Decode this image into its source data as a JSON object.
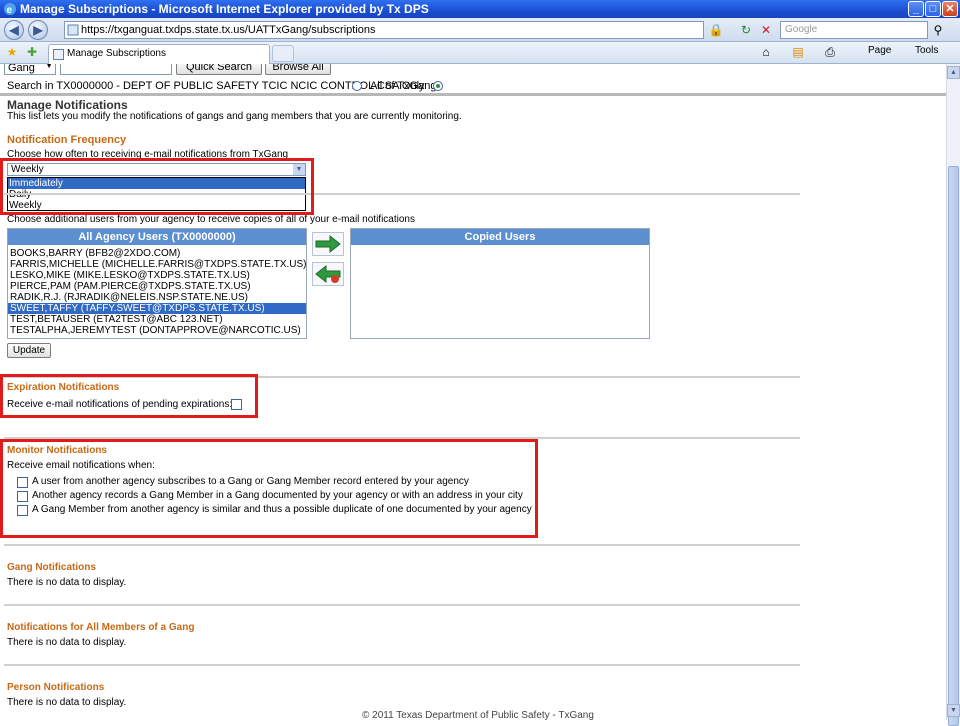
{
  "window": {
    "title": "Manage Subscriptions - Microsoft Internet Explorer provided by Tx DPS"
  },
  "browser": {
    "url": "https://txganguat.txdps.state.tx.us/UATTxGang/subscriptions",
    "search_placeholder": "Google",
    "tab_title": "Manage Subscriptions",
    "toolbar": {
      "page": "Page",
      "tools": "Tools"
    }
  },
  "search_bar": {
    "type_value": "Gang",
    "quick_search": "Quick Search",
    "browse_all": "Browse All",
    "scope_text": "Search in TX0000000 - DEPT OF PUBLIC SAFETY TCIC NCIC CONTROL CSA Only",
    "scope_all": "All of TxGang"
  },
  "page": {
    "title": "Manage Notifications",
    "intro": "This list lets you modify the notifications of gangs and gang members that you are currently monitoring."
  },
  "frequency": {
    "heading": "Notification Frequency",
    "label": "Choose how often to receiving e-mail notifications from TxGang",
    "selected": "Weekly",
    "options": [
      "Immediately",
      "Daily",
      "Weekly"
    ],
    "highlighted": "Immediately"
  },
  "copies": {
    "label": "Choose additional users from your agency to receive copies of all of your e-mail notifications",
    "agency_header": "All Agency Users (TX0000000)",
    "copied_header": "Copied Users",
    "users": [
      "BOOKS,BARRY (BFB2@2XDO.COM)",
      "FARRIS,MICHELLE (MICHELLE.FARRIS@TXDPS.STATE.TX.US)",
      "LESKO,MIKE (MIKE.LESKO@TXDPS.STATE.TX.US)",
      "PIERCE,PAM (PAM.PIERCE@TXDPS.STATE.TX.US)",
      "RADIK,R.J. (RJRADIK@NELEIS.NSP.STATE.NE.US)",
      "SWEET,TAFFY (TAFFY.SWEET@TXDPS.STATE.TX.US)",
      "TEST,BETAUSER (ETA2TEST@ABC 123.NET)",
      "TESTALPHA,JEREMYTEST (DONTAPPROVE@NARCOTIC.US)"
    ],
    "update": "Update"
  },
  "expiration": {
    "heading": "Expiration Notifications",
    "label": "Receive e-mail notifications of pending expirations:"
  },
  "monitor": {
    "heading": "Monitor Notifications",
    "label": "Receive email notifications when:",
    "options": [
      "A user from another agency subscribes to a Gang or Gang Member record entered by your agency",
      "Another agency records a Gang Member in a Gang documented by your agency or with an address in your city",
      "A Gang Member from another agency is similar and thus a possible duplicate of one documented by your agency"
    ]
  },
  "gang": {
    "heading": "Gang Notifications",
    "empty": "There is no data to display."
  },
  "members": {
    "heading": "Notifications for All Members of a Gang",
    "empty": "There is no data to display."
  },
  "person": {
    "heading": "Person Notifications",
    "empty": "There is no data to display."
  },
  "footer": "© 2011 Texas Department of Public Safety - TxGang",
  "colors": {
    "accent": "#c66a16",
    "highlight": "#e11b1b",
    "list_header": "#5b8fd0",
    "selection": "#316ac5"
  }
}
